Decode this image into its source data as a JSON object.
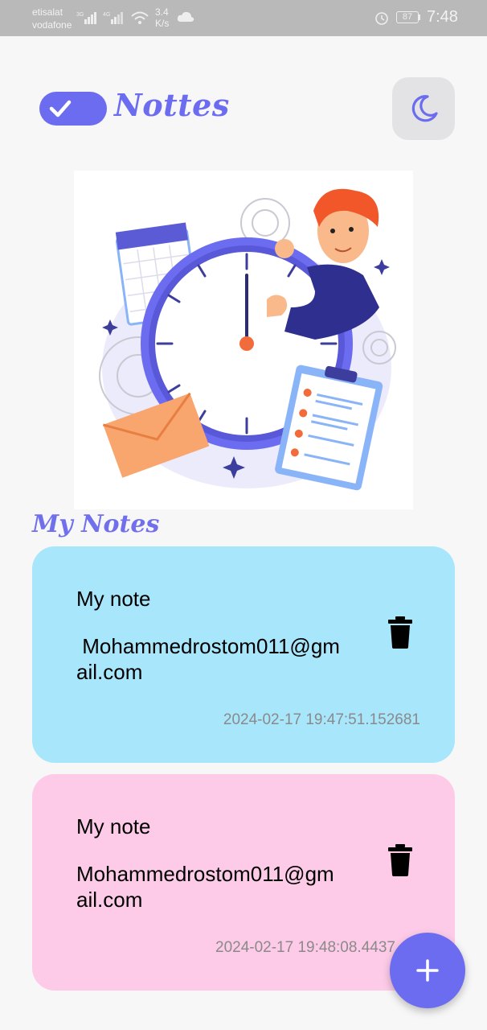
{
  "status_bar": {
    "carrier_1": "etisalat",
    "carrier_2": "vodafone",
    "net_1": "3G",
    "net_2": "4G",
    "speed_value": "3.4",
    "speed_unit": "K/s",
    "battery": "87",
    "time": "7:48",
    "icons": [
      "signal-icon",
      "wifi-icon",
      "cloud-icon",
      "alarm-icon",
      "battery-icon"
    ]
  },
  "header": {
    "title": "Nottes",
    "logo_icon": "check-toggle-icon",
    "theme_icon": "moon-icon"
  },
  "section_title": "My Notes",
  "notes": [
    {
      "title": "My note",
      "body": " Mohammedrostom011@gmail.com",
      "date": "2024-02-17 19:47:51.152681",
      "color": "#a8e6fb"
    },
    {
      "title": "My note",
      "body": "Mohammedrostom011@gmail.com",
      "date": "2024-02-17 19:48:08.4437",
      "color": "#fdcbe8"
    }
  ],
  "fab_icon": "plus-icon",
  "colors": {
    "accent": "#6c6cf0",
    "background": "#f7f7f8"
  }
}
